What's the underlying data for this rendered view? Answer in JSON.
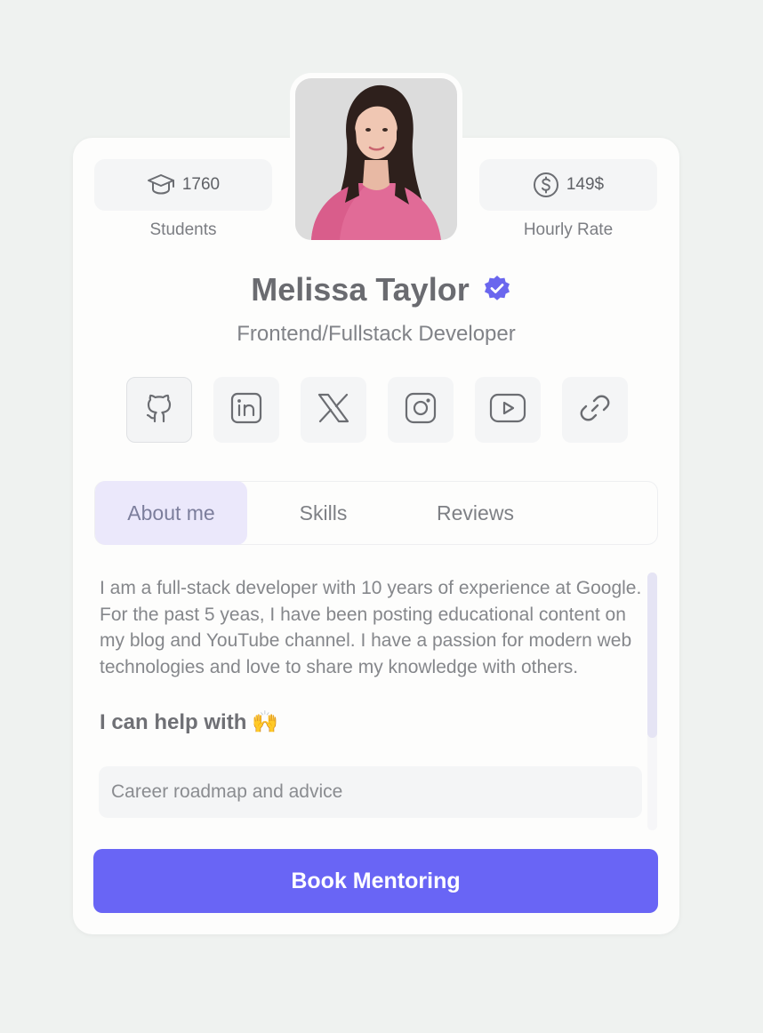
{
  "profile": {
    "name": "Melissa Taylor",
    "title": "Frontend/Fullstack Developer",
    "verified_icon": "verified-badge-icon"
  },
  "stats": {
    "students": {
      "value": "1760",
      "label": "Students",
      "icon": "graduation-cap-icon"
    },
    "rate": {
      "value": "149$",
      "label": "Hourly Rate",
      "icon": "dollar-circle-icon"
    }
  },
  "socials": [
    {
      "icon": "github-icon",
      "state": "hovered"
    },
    {
      "icon": "linkedin-icon"
    },
    {
      "icon": "x-icon"
    },
    {
      "icon": "instagram-icon"
    },
    {
      "icon": "youtube-icon"
    },
    {
      "icon": "link-icon"
    }
  ],
  "tabs": [
    {
      "label": "About me",
      "active": true
    },
    {
      "label": "Skills"
    },
    {
      "label": "Reviews"
    }
  ],
  "about": {
    "text": "I am a full-stack developer with 10 years of experience at Google. For the past 5 yeas, I have been posting educational content on my blog and YouTube channel. I have a passion for modern web technologies and love to share my knowledge with others.",
    "help_heading": "I can help with",
    "help_emoji": "🙌",
    "help_items": [
      "Career roadmap and advice"
    ]
  },
  "cta": {
    "label": "Book Mentoring"
  },
  "colors": {
    "accent": "#6965f5",
    "active_tab_bg": "#ebe8fb",
    "verified": "#6a66ee"
  }
}
